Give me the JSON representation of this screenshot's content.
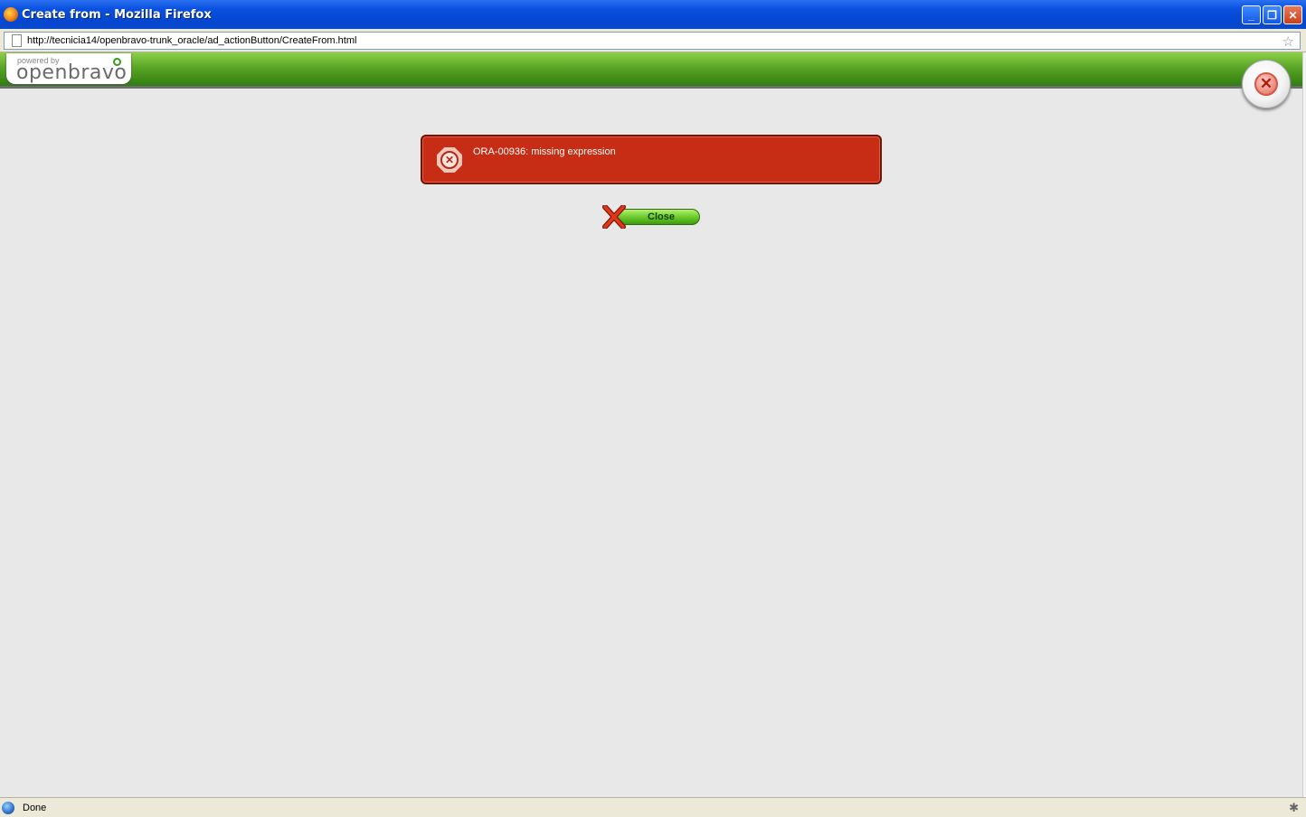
{
  "window": {
    "title": "Create from - Mozilla Firefox",
    "controls": {
      "minimize": "_",
      "restore": "❐",
      "close": "✕"
    }
  },
  "address_bar": {
    "url": "http://tecnicia14/openbravo-trunk_oracle/ad_actionButton/CreateFrom.html"
  },
  "header": {
    "logo_powered_by": "powered by",
    "logo_brand": "openbravo"
  },
  "error": {
    "message": "ORA-00936: missing expression",
    "color": "#c62d14"
  },
  "actions": {
    "close_label": "Close"
  },
  "status_bar": {
    "text": "Done"
  },
  "icons": {
    "app": "firefox-icon",
    "page": "page-icon",
    "bookmark": "star-icon",
    "error": "error-stop-icon",
    "close": "close-x-icon",
    "status": "globe-icon"
  },
  "colors": {
    "titlebar": "#0a52e0",
    "header_green": "#5aa625",
    "button_green": "#6ccc2c",
    "page_background": "#e8e8e8"
  }
}
